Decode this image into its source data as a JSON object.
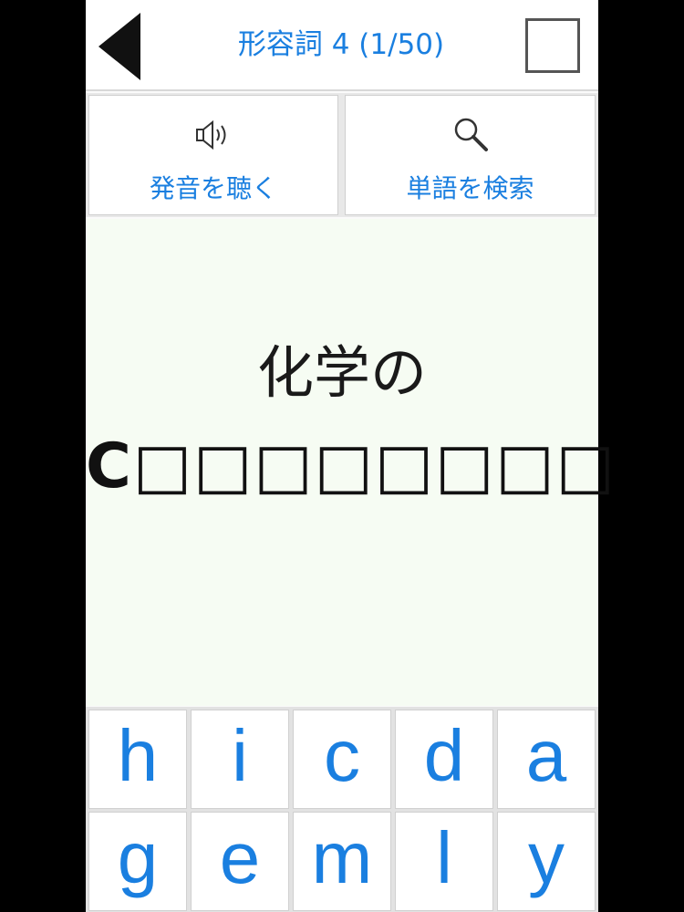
{
  "header": {
    "title": "形容詞 4 (1/50)"
  },
  "actions": {
    "listen_label": "発音を聴く",
    "search_label": "単語を検索"
  },
  "question": {
    "line1": "化学の",
    "first_letter": "C",
    "blanks": "□□□□□□□□"
  },
  "keyboard": {
    "keys": [
      "h",
      "i",
      "c",
      "d",
      "a",
      "g",
      "e",
      "m",
      "l",
      "y"
    ]
  },
  "colors": {
    "accent": "#1a7fe0",
    "question_bg": "#f6fcf3"
  },
  "icons": {
    "back": "triangle-left-icon",
    "listen": "speaker-icon",
    "search": "magnifier-icon"
  }
}
